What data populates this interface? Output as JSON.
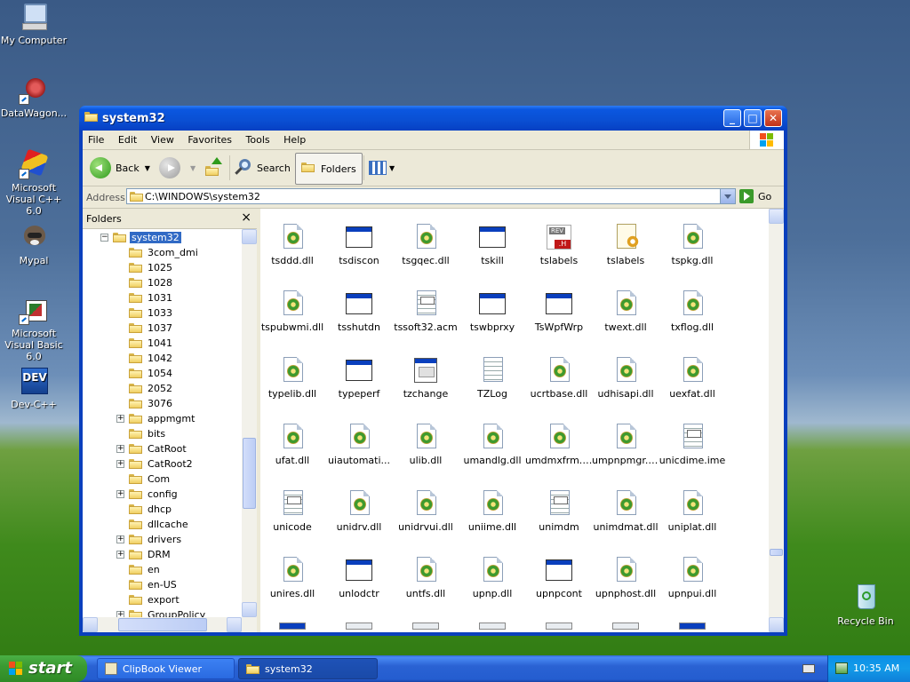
{
  "desktop": {
    "icons": [
      {
        "label": "My Computer",
        "icon": "my-computer-icon"
      },
      {
        "label": "DataWagon...",
        "icon": "datawagon-icon"
      },
      {
        "label": "Microsoft Visual C++ 6.0",
        "icon": "visual-cpp-icon"
      },
      {
        "label": "Mypal",
        "icon": "mypal-icon"
      },
      {
        "label": "Microsoft Visual Basic 6.0",
        "icon": "visual-basic-icon"
      },
      {
        "label": "Dev-C++",
        "icon": "dev-cpp-icon"
      },
      {
        "label": "Recycle Bin",
        "icon": "recycle-bin-icon"
      }
    ],
    "dev_badge": "DEV"
  },
  "window": {
    "title": "system32",
    "menu": [
      "File",
      "Edit",
      "View",
      "Favorites",
      "Tools",
      "Help"
    ],
    "toolbar": {
      "back": "Back",
      "search": "Search",
      "folders": "Folders"
    },
    "address": {
      "label": "Address",
      "value": "C:\\WINDOWS\\system32",
      "go": "Go"
    }
  },
  "folders_pane": {
    "title": "Folders",
    "close": "×",
    "selected": "system32",
    "items": [
      {
        "name": "3com_dmi",
        "expandable": false
      },
      {
        "name": "1025",
        "expandable": false
      },
      {
        "name": "1028",
        "expandable": false
      },
      {
        "name": "1031",
        "expandable": false
      },
      {
        "name": "1033",
        "expandable": false
      },
      {
        "name": "1037",
        "expandable": false
      },
      {
        "name": "1041",
        "expandable": false
      },
      {
        "name": "1042",
        "expandable": false
      },
      {
        "name": "1054",
        "expandable": false
      },
      {
        "name": "2052",
        "expandable": false
      },
      {
        "name": "3076",
        "expandable": false
      },
      {
        "name": "appmgmt",
        "expandable": true
      },
      {
        "name": "bits",
        "expandable": false
      },
      {
        "name": "CatRoot",
        "expandable": true
      },
      {
        "name": "CatRoot2",
        "expandable": true
      },
      {
        "name": "Com",
        "expandable": false
      },
      {
        "name": "config",
        "expandable": true
      },
      {
        "name": "dhcp",
        "expandable": false
      },
      {
        "name": "dllcache",
        "expandable": false
      },
      {
        "name": "drivers",
        "expandable": true
      },
      {
        "name": "DRM",
        "expandable": true
      },
      {
        "name": "en",
        "expandable": false
      },
      {
        "name": "en-US",
        "expandable": false
      },
      {
        "name": "export",
        "expandable": false
      },
      {
        "name": "GroupPolicy",
        "expandable": true
      }
    ]
  },
  "files": [
    {
      "name": "tsddd.dll",
      "icon": "dll"
    },
    {
      "name": "tsdiscon",
      "icon": "exe"
    },
    {
      "name": "tsgqec.dll",
      "icon": "dll"
    },
    {
      "name": "tskill",
      "icon": "exe"
    },
    {
      "name": "tslabels",
      "icon": "res"
    },
    {
      "name": "tslabels",
      "icon": "cfg"
    },
    {
      "name": "tspkg.dll",
      "icon": "dll"
    },
    {
      "name": "tspubwmi.dll",
      "icon": "dll"
    },
    {
      "name": "tsshutdn",
      "icon": "exe"
    },
    {
      "name": "tssoft32.acm",
      "icon": "sys"
    },
    {
      "name": "tswbprxy",
      "icon": "exe"
    },
    {
      "name": "TsWpfWrp",
      "icon": "exe"
    },
    {
      "name": "twext.dll",
      "icon": "dll"
    },
    {
      "name": "txflog.dll",
      "icon": "dll"
    },
    {
      "name": "typelib.dll",
      "icon": "dll"
    },
    {
      "name": "typeperf",
      "icon": "exe"
    },
    {
      "name": "tzchange",
      "icon": "bigexe"
    },
    {
      "name": "TZLog",
      "icon": "txt"
    },
    {
      "name": "ucrtbase.dll",
      "icon": "dll"
    },
    {
      "name": "udhisapi.dll",
      "icon": "dll"
    },
    {
      "name": "uexfat.dll",
      "icon": "dll"
    },
    {
      "name": "ufat.dll",
      "icon": "dll"
    },
    {
      "name": "uiautomati...",
      "icon": "dll"
    },
    {
      "name": "ulib.dll",
      "icon": "dll"
    },
    {
      "name": "umandlg.dll",
      "icon": "dll"
    },
    {
      "name": "umdmxfrm.dll",
      "icon": "dll"
    },
    {
      "name": "umpnpmgr.dll",
      "icon": "dll"
    },
    {
      "name": "unicdime.ime",
      "icon": "sys"
    },
    {
      "name": "unicode",
      "icon": "sys"
    },
    {
      "name": "unidrv.dll",
      "icon": "dll"
    },
    {
      "name": "unidrvui.dll",
      "icon": "dll"
    },
    {
      "name": "uniime.dll",
      "icon": "dll"
    },
    {
      "name": "unimdm",
      "icon": "sys"
    },
    {
      "name": "unimdmat.dll",
      "icon": "dll"
    },
    {
      "name": "uniplat.dll",
      "icon": "dll"
    },
    {
      "name": "unires.dll",
      "icon": "dll"
    },
    {
      "name": "unlodctr",
      "icon": "exe"
    },
    {
      "name": "untfs.dll",
      "icon": "dll"
    },
    {
      "name": "upnp.dll",
      "icon": "dll"
    },
    {
      "name": "upnpcont",
      "icon": "exe"
    },
    {
      "name": "upnphost.dll",
      "icon": "dll"
    },
    {
      "name": "upnpui.dll",
      "icon": "dll"
    }
  ],
  "taskbar": {
    "start": "start",
    "tasks": [
      {
        "label": "ClipBook Viewer",
        "active": false
      },
      {
        "label": "system32",
        "active": true
      }
    ],
    "clock": "10:35 AM"
  }
}
